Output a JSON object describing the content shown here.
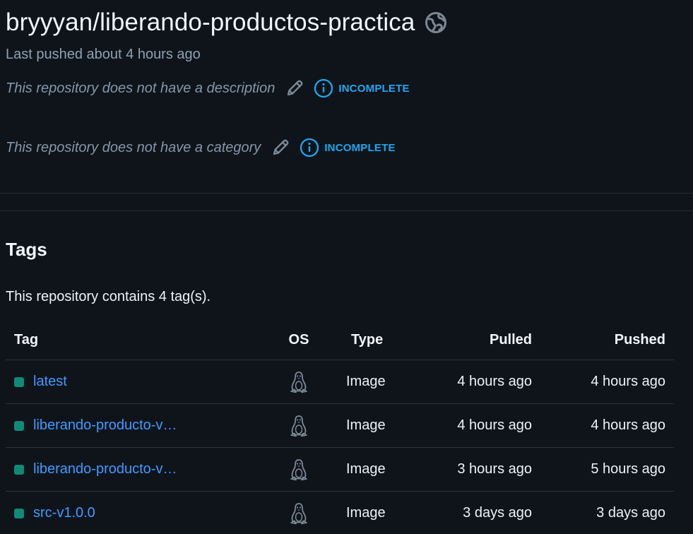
{
  "repo": {
    "title": "bryyyan/liberando-productos-practica",
    "visibility_icon": "globe-icon",
    "last_pushed": "Last pushed about 4 hours ago"
  },
  "description": {
    "text": "This repository does not have a description",
    "edit_icon": "pencil-icon",
    "status": "INCOMPLETE"
  },
  "category": {
    "text": "This repository does not have a category",
    "edit_icon": "pencil-icon",
    "status": "INCOMPLETE"
  },
  "tags": {
    "heading": "Tags",
    "count_text": "This repository contains 4 tag(s).",
    "columns": {
      "tag": "Tag",
      "os": "OS",
      "type": "Type",
      "pulled": "Pulled",
      "pushed": "Pushed"
    },
    "rows": [
      {
        "name": "latest",
        "os_icon": "linux-icon",
        "type": "Image",
        "pulled": "4 hours ago",
        "pushed": "4 hours ago"
      },
      {
        "name": "liberando-producto-v…",
        "os_icon": "linux-icon",
        "type": "Image",
        "pulled": "4 hours ago",
        "pushed": "4 hours ago"
      },
      {
        "name": "liberando-producto-v…",
        "os_icon": "linux-icon",
        "type": "Image",
        "pulled": "3 hours ago",
        "pushed": "5 hours ago"
      },
      {
        "name": "src-v1.0.0",
        "os_icon": "linux-icon",
        "type": "Image",
        "pulled": "3 days ago",
        "pushed": "3 days ago"
      }
    ]
  },
  "colors": {
    "background": "#0f141b",
    "link": "#3d9bff",
    "status": "#1ea7f0",
    "tag_dot": "#118a77"
  }
}
